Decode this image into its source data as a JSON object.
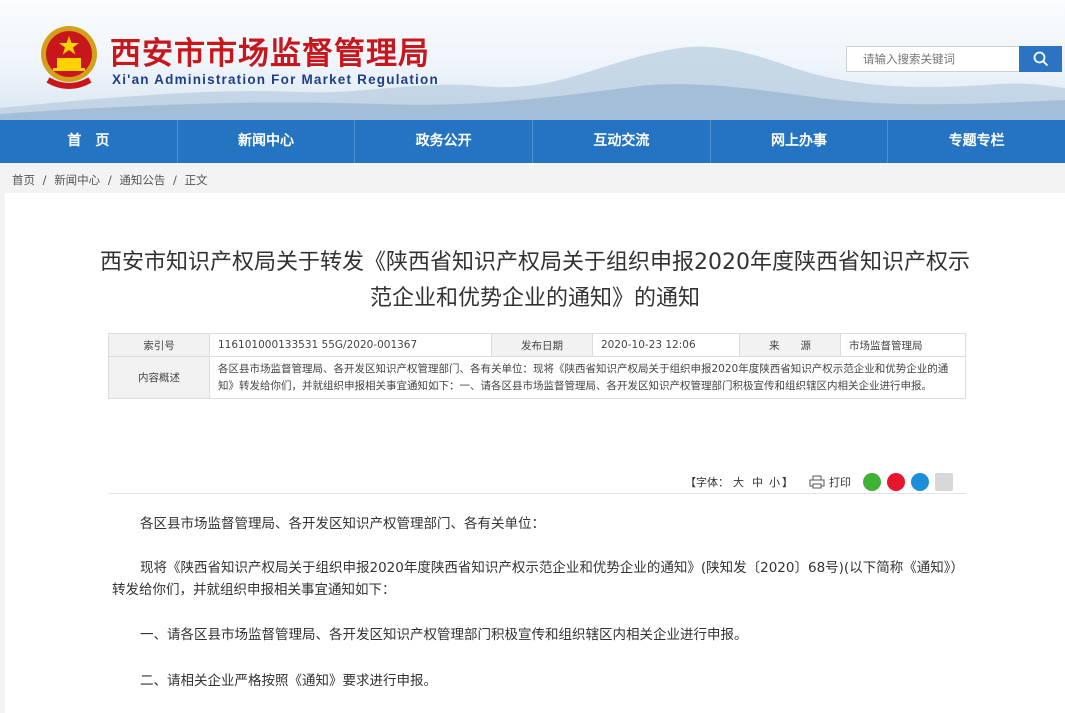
{
  "header": {
    "title": "西安市市场监督管理局",
    "subtitle": "Xi'an Administration For Market Regulation",
    "search_placeholder": "请输入搜索关键词"
  },
  "nav": [
    "首　页",
    "新闻中心",
    "政务公开",
    "互动交流",
    "网上办事",
    "专题专栏"
  ],
  "breadcrumb": [
    "首页",
    "/",
    "新闻中心",
    "/",
    "通知公告",
    "/",
    "正文"
  ],
  "article": {
    "title": "西安市知识产权局关于转发《陕西省知识产权局关于组织申报2020年度陕西省知识产权示范企业和优势企业的通知》的通知",
    "meta": {
      "index_label": "索引号",
      "index_value": "116101000133531 55G/2020-001367",
      "date_label": "发布日期",
      "date_value": "2020-10-23 12:06",
      "source_label": "来　　源",
      "source_value": "市场监督管理局",
      "summary_label": "内容概述",
      "summary_value": "各区县市场监督管理局、各开发区知识产权管理部门、各有关单位：现将《陕西省知识产权局关于组织申报2020年度陕西省知识产权示范企业和优势企业的通知》转发给你们，并就组织申报相关事宜通知如下：一、请各区县市场监督管理局、各开发区知识产权管理部门积极宣传和组织辖区内相关企业进行申报。"
    },
    "tools": {
      "font_label": "【字体：",
      "font_big": "大",
      "font_mid": "中",
      "font_small": "小",
      "font_end": "】",
      "print": "打印"
    },
    "paragraphs": [
      "各区县市场监督管理局、各开发区知识产权管理部门、各有关单位：",
      "现将《陕西省知识产权局关于组织申报2020年度陕西省知识产权示范企业和优势企业的通知》(陕知发〔2020〕68号)(以下简称《通知》）转发给你们，并就组织申报相关事宜通知如下：",
      "一、请各区县市场监督管理局、各开发区知识产权管理部门积极宣传和组织辖区内相关企业进行申报。",
      "二、请相关企业严格按照《通知》要求进行申报。"
    ]
  },
  "colors": {
    "brand_red": "#c8161d",
    "nav_blue": "#2474c2",
    "search_blue": "#2b74c4"
  }
}
